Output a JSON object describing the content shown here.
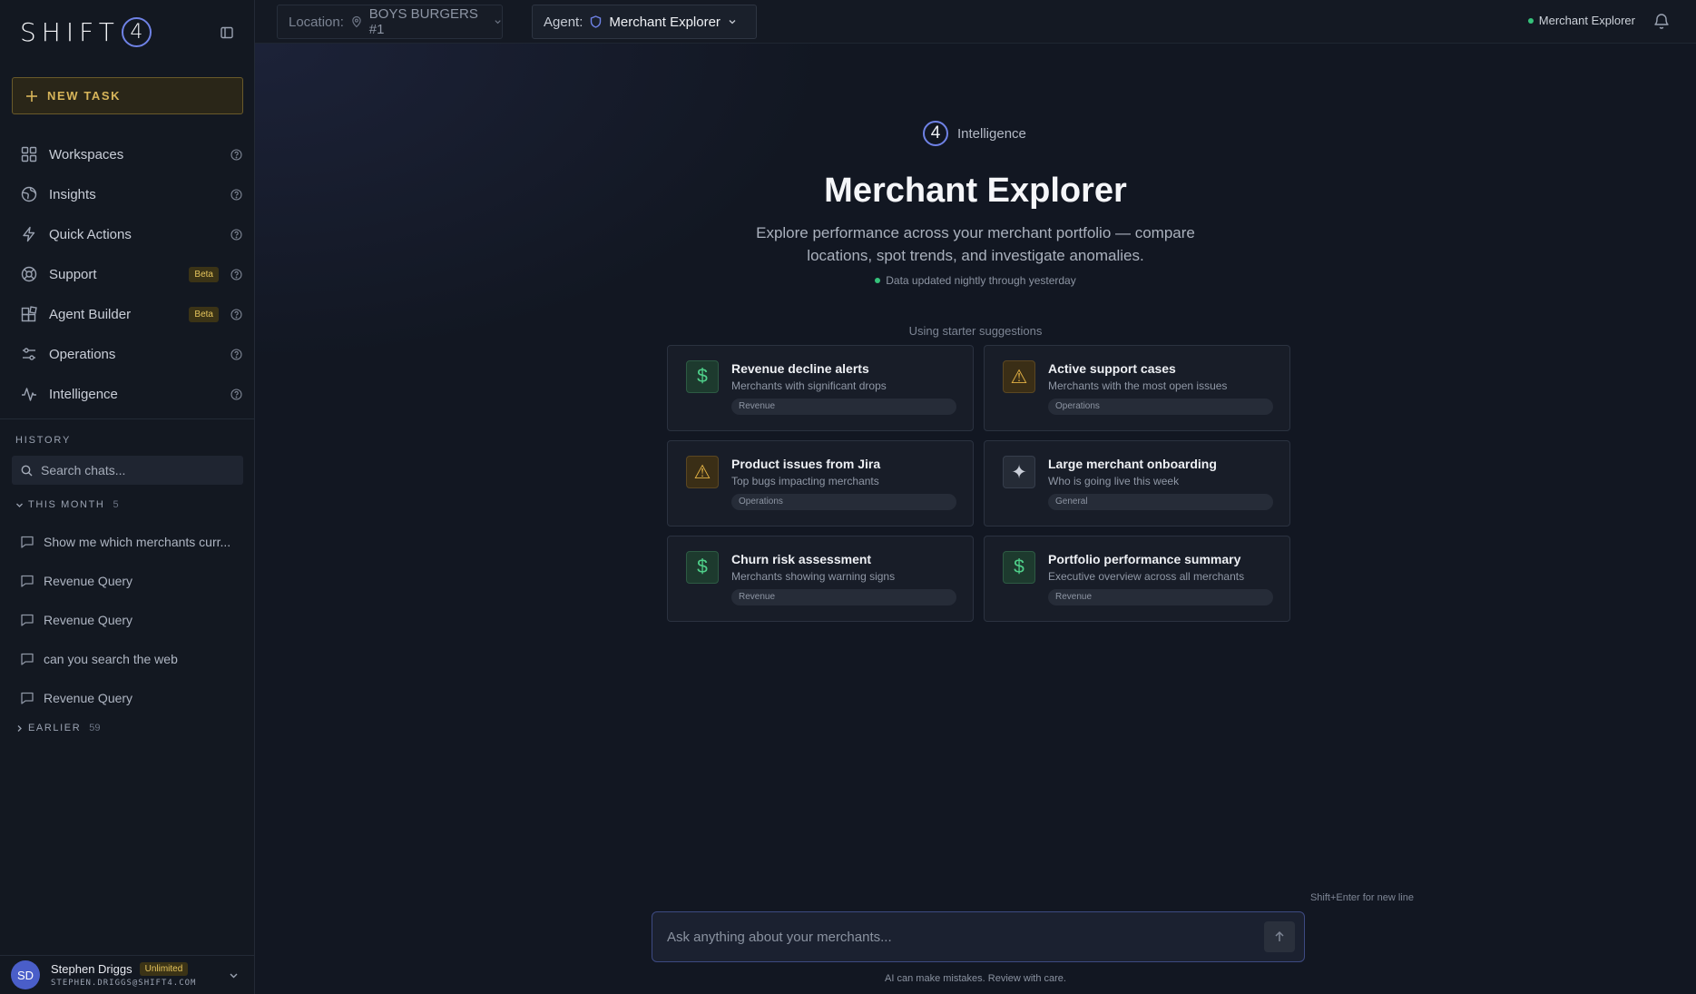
{
  "brand": {
    "logo_text": "SHIFT",
    "logo_mark": "4"
  },
  "sidebar": {
    "new_task_label": "NEW TASK",
    "items": [
      {
        "label": "Workspaces",
        "icon": "grid-icon",
        "beta": ""
      },
      {
        "label": "Insights",
        "icon": "globe-icon",
        "beta": ""
      },
      {
        "label": "Quick Actions",
        "icon": "lightning-icon",
        "beta": ""
      },
      {
        "label": "Support",
        "icon": "lifebuoy-icon",
        "beta": "Beta"
      },
      {
        "label": "Agent Builder",
        "icon": "blocks-icon",
        "beta": "Beta"
      },
      {
        "label": "Operations",
        "icon": "sliders-icon",
        "beta": ""
      },
      {
        "label": "Intelligence",
        "icon": "pulse-icon",
        "beta": ""
      }
    ],
    "history_title": "HISTORY",
    "search_placeholder": "Search chats...",
    "this_month": {
      "label": "THIS MONTH",
      "count": "5"
    },
    "chats": [
      "Show me which merchants curr...",
      "Revenue Query",
      "Revenue Query",
      "can you search the web",
      "Revenue Query"
    ],
    "earlier": {
      "label": "EARLIER",
      "count": "59"
    }
  },
  "user": {
    "initials": "SD",
    "name": "Stephen Driggs",
    "plan": "Unlimited",
    "email": "STEPHEN.DRIGGS@SHIFT4.COM"
  },
  "topbar": {
    "location_label": "Location:",
    "location_value": "BOYS BURGERS #1",
    "agent_label": "Agent:",
    "agent_value": "Merchant Explorer",
    "status_text": "Merchant Explorer"
  },
  "main": {
    "brand_mark": "4",
    "brand_label": "Intelligence",
    "title": "Merchant Explorer",
    "subtitle": "Explore performance across your merchant portfolio — compare locations, spot trends, and investigate anomalies.",
    "updated": "Data updated nightly through yesterday",
    "using": "Using starter suggestions",
    "cards": [
      {
        "title": "Revenue decline alerts",
        "desc": "Merchants with significant drops",
        "tag": "Revenue",
        "icon": "$",
        "tone": "green"
      },
      {
        "title": "Active support cases",
        "desc": "Merchants with the most open issues",
        "tag": "Operations",
        "icon": "⚠",
        "tone": "amber"
      },
      {
        "title": "Product issues from Jira",
        "desc": "Top bugs impacting merchants",
        "tag": "Operations",
        "icon": "⚠",
        "tone": "amber"
      },
      {
        "title": "Large merchant onboarding",
        "desc": "Who is going live this week",
        "tag": "General",
        "icon": "✦",
        "tone": "gray"
      },
      {
        "title": "Churn risk assessment",
        "desc": "Merchants showing warning signs",
        "tag": "Revenue",
        "icon": "$",
        "tone": "green"
      },
      {
        "title": "Portfolio performance summary",
        "desc": "Executive overview across all merchants",
        "tag": "Revenue",
        "icon": "$",
        "tone": "green"
      }
    ],
    "hint": "Shift+Enter for new line",
    "ask_placeholder": "Ask anything about your merchants...",
    "disclaimer": "AI can make mistakes. Review with care."
  },
  "colors": {
    "accent": "#6f82e6",
    "gold": "#d7b55a",
    "online": "#35c27a"
  }
}
